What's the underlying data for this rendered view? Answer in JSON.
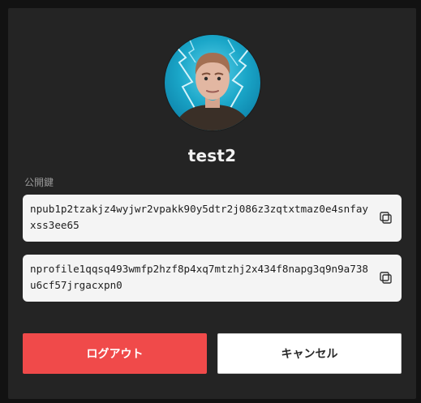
{
  "profile": {
    "username": "test2",
    "avatar": "avatar-photo"
  },
  "keys": {
    "label": "公開鍵",
    "npub": "npub1p2tzakjz4wyjwr2vpakk90y5dtr2j086z3zqtxtmaz0e4snfayxss3ee65",
    "nprofile": "nprofile1qqsq493wmfp2hzf8p4xq7mtzhj2x434f8napg3q9n9a738u6cf57jrgacxpn0",
    "copy_icon": "copy-icon"
  },
  "actions": {
    "logout_label": "ログアウト",
    "cancel_label": "キャンセル"
  },
  "colors": {
    "panel": "#242424",
    "logout": "#f04a4a",
    "cancel": "#ffffff",
    "keybox": "#f4f4f4"
  }
}
